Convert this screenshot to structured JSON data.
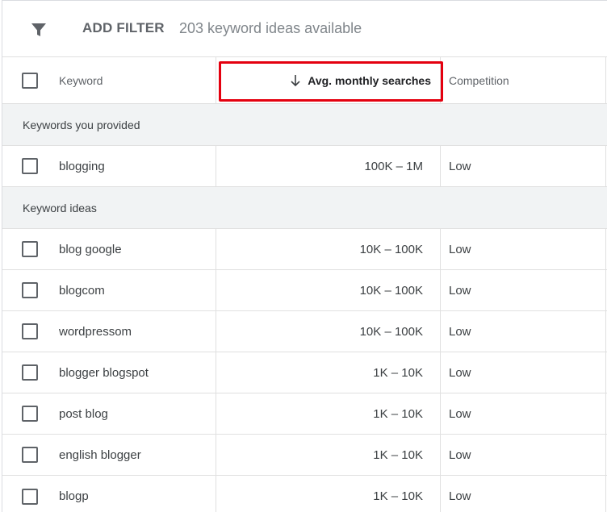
{
  "toolbar": {
    "add_filter_label": "ADD FILTER",
    "ideas_count": "203 keyword ideas available"
  },
  "table": {
    "headers": {
      "keyword": "Keyword",
      "avg_monthly_searches": "Avg. monthly searches",
      "competition": "Competition"
    },
    "sort": {
      "column": "avg_monthly_searches",
      "direction": "descending"
    },
    "groups": [
      {
        "label": "Keywords you provided",
        "rows": [
          {
            "keyword": "blogging",
            "searches": "100K – 1M",
            "competition": "Low"
          }
        ]
      },
      {
        "label": "Keyword ideas",
        "rows": [
          {
            "keyword": "blog google",
            "searches": "10K – 100K",
            "competition": "Low"
          },
          {
            "keyword": "blogcom",
            "searches": "10K – 100K",
            "competition": "Low"
          },
          {
            "keyword": "wordpressom",
            "searches": "10K – 100K",
            "competition": "Low"
          },
          {
            "keyword": "blogger blogspot",
            "searches": "1K – 10K",
            "competition": "Low"
          },
          {
            "keyword": "post blog",
            "searches": "1K – 10K",
            "competition": "Low"
          },
          {
            "keyword": "english blogger",
            "searches": "1K – 10K",
            "competition": "Low"
          },
          {
            "keyword": "blogp",
            "searches": "1K – 10K",
            "competition": "Low"
          }
        ]
      }
    ]
  },
  "colors": {
    "highlight_border": "#e4000f",
    "group_background": "#f1f3f4",
    "divider": "#e0e0e0"
  }
}
